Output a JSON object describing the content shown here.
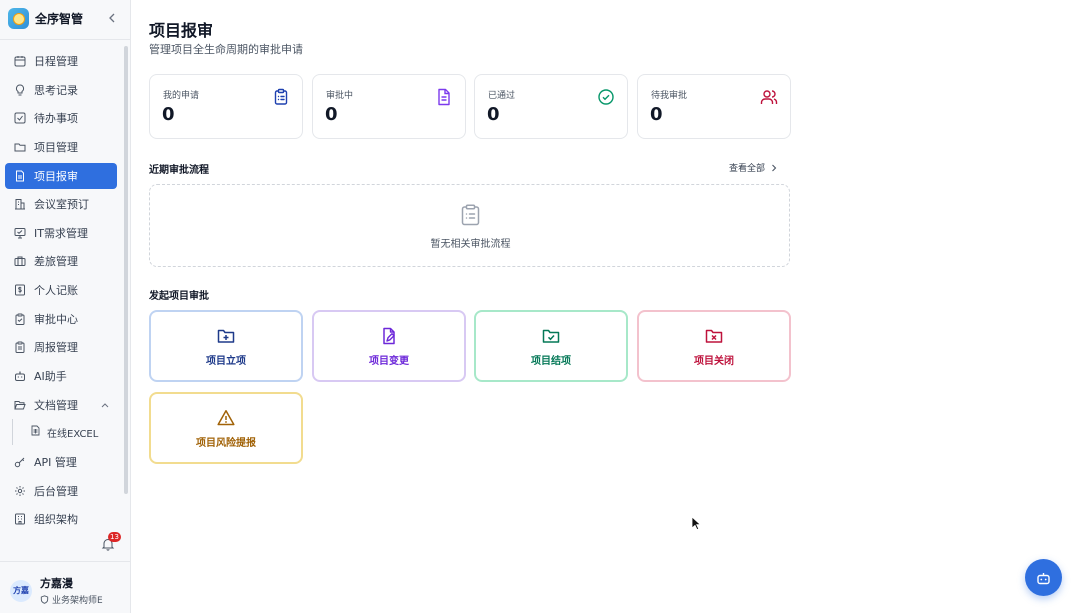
{
  "app": {
    "name": "全序智管"
  },
  "sidebar": {
    "items": [
      {
        "label": "日程管理",
        "icon": "calendar-icon"
      },
      {
        "label": "思考记录",
        "icon": "lightbulb-icon"
      },
      {
        "label": "待办事项",
        "icon": "checkbox-icon"
      },
      {
        "label": "项目管理",
        "icon": "folder-icon"
      },
      {
        "label": "项目报审",
        "icon": "document-icon",
        "active": true
      },
      {
        "label": "会议室预订",
        "icon": "building-icon"
      },
      {
        "label": "IT需求管理",
        "icon": "monitor-icon"
      },
      {
        "label": "差旅管理",
        "icon": "briefcase-icon"
      },
      {
        "label": "个人记账",
        "icon": "dollar-icon"
      },
      {
        "label": "审批中心",
        "icon": "clipboard-icon"
      },
      {
        "label": "周报管理",
        "icon": "report-icon"
      },
      {
        "label": "AI助手",
        "icon": "robot-icon"
      },
      {
        "label": "文档管理",
        "icon": "folder-open-icon",
        "expanded": true
      },
      {
        "label": "API 管理",
        "icon": "key-icon"
      },
      {
        "label": "后台管理",
        "icon": "gear-icon"
      },
      {
        "label": "组织架构",
        "icon": "org-icon"
      }
    ],
    "sub_item": {
      "label": "在线EXCEL",
      "icon": "spreadsheet-icon"
    },
    "notification_count": "13"
  },
  "user": {
    "avatar_text": "方嘉",
    "name": "方嘉漫",
    "role": "业务架构师E"
  },
  "page": {
    "title": "项目报审",
    "subtitle": "管理项目全生命周期的审批申请"
  },
  "stats": [
    {
      "label": "我的申请",
      "value": "0",
      "icon": "clipboard-list-icon",
      "color": "#1e40af"
    },
    {
      "label": "审批中",
      "value": "0",
      "icon": "file-text-icon",
      "color": "#7c3aed"
    },
    {
      "label": "已通过",
      "value": "0",
      "icon": "check-circle-icon",
      "color": "#059669"
    },
    {
      "label": "待我审批",
      "value": "0",
      "icon": "users-icon",
      "color": "#be123c"
    }
  ],
  "recent": {
    "title": "近期审批流程",
    "view_all": "查看全部",
    "empty_text": "暂无相关审批流程"
  },
  "actions_section": {
    "title": "发起项目审批"
  },
  "actions": [
    {
      "label": "项目立项",
      "icon": "folder-plus-icon",
      "color": "#1e3a8a",
      "border": "#bfd3f2"
    },
    {
      "label": "项目变更",
      "icon": "file-edit-icon",
      "color": "#6d28d9",
      "border": "#d8c9f3"
    },
    {
      "label": "项目结项",
      "icon": "folder-check-icon",
      "color": "#047857",
      "border": "#a7e8c9"
    },
    {
      "label": "项目关闭",
      "icon": "folder-x-icon",
      "color": "#be123c",
      "border": "#f3c2cd"
    },
    {
      "label": "项目风险提报",
      "icon": "warning-icon",
      "color": "#a16207",
      "border": "#f2dc8f"
    }
  ]
}
